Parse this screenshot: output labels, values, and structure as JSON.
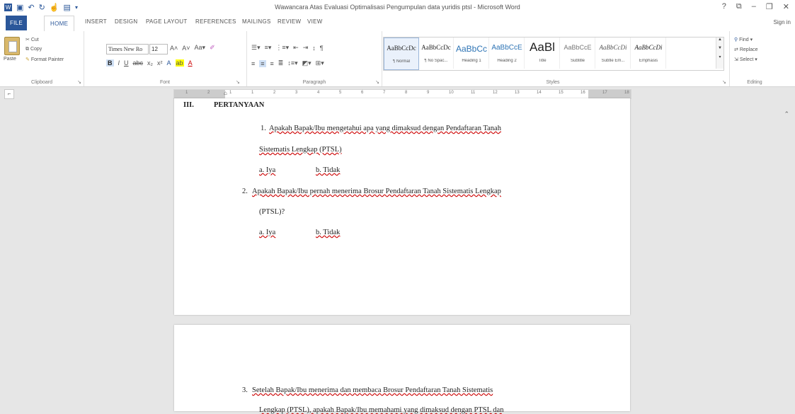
{
  "window": {
    "title": "Wawancara Atas Evaluasi Optimalisasi Pengumpulan data yuridis ptsl - Microsoft Word",
    "controls": [
      "?",
      "⧉",
      "–",
      "❐",
      "✕"
    ]
  },
  "tabs": [
    "FILE",
    "HOME",
    "INSERT",
    "DESIGN",
    "PAGE LAYOUT",
    "REFERENCES",
    "MAILINGS",
    "REVIEW",
    "VIEW"
  ],
  "sign_in": "Sign in",
  "clipboard": {
    "paste": "Paste",
    "cut": "Cut",
    "copy": "Copy",
    "format_painter": "Format Painter",
    "label": "Clipboard"
  },
  "font": {
    "name": "Times New Ro",
    "size": "12",
    "label": "Font"
  },
  "paragraph": {
    "label": "Paragraph"
  },
  "styles": {
    "label": "Styles",
    "items": [
      {
        "preview": "AaBbCcDc",
        "name": "¶ Normal"
      },
      {
        "preview": "AaBbCcDc",
        "name": "¶ No Spac..."
      },
      {
        "preview": "AaBbCc",
        "name": "Heading 1"
      },
      {
        "preview": "AaBbCcE",
        "name": "Heading 2"
      },
      {
        "preview": "AaBl",
        "name": "Title"
      },
      {
        "preview": "AaBbCcE",
        "name": "Subtitle"
      },
      {
        "preview": "AaBbCcDi",
        "name": "Subtle Em..."
      },
      {
        "preview": "AaBbCcDi",
        "name": "Emphasis"
      }
    ]
  },
  "editing": {
    "find": "Find",
    "replace": "Replace",
    "select": "Select",
    "label": "Editing"
  },
  "ruler_numbers": [
    "1",
    "2",
    "1",
    "1",
    "2",
    "3",
    "4",
    "5",
    "6",
    "7",
    "8",
    "9",
    "10",
    "11",
    "12",
    "13",
    "14",
    "15",
    "16",
    "17",
    "18"
  ],
  "document": {
    "section_number": "III.",
    "section_title": "PERTANYAAN",
    "q1_num": "1.",
    "q1_line1": "Apakah Bapak/Ibu mengetahui apa yang dimaksud dengan Pendaftaran Tanah",
    "q1_line2": "Sistematis Lengkap (PTSL)",
    "q1_opt_a": "a.  Iya",
    "q1_opt_b": "b. Tidak",
    "q2_num": "2.",
    "q2_line1": "Apakah Bapak/Ibu pernah menerima Brosur Pendaftaran Tanah Sistematis Lengkap",
    "q2_line2": "(PTSL)?",
    "q2_opt_a": "a.  Iya",
    "q2_opt_b": "b. Tidak",
    "q3_num": "3.",
    "q3_line1": "Setelah Bapak/Ibu menerima dan membaca Brosur Pendaftaran Tanah Sistematis",
    "q3_line2": "Lengkap (PTSL), apakah Bapak/Ibu memahami yang dimaksud dengan PTSL dan"
  }
}
